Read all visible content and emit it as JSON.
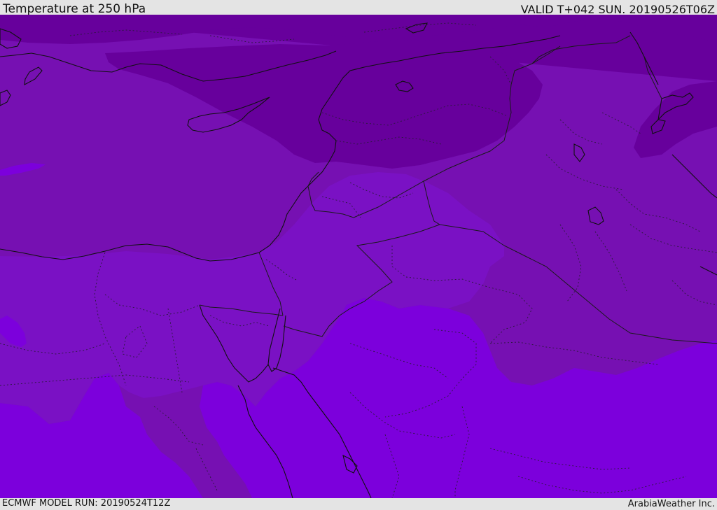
{
  "header": {
    "title": "Temperature at 250 hPa",
    "valid_time": "VALID T+042 SUN. 20190526T06Z"
  },
  "footer": {
    "model_run": "ECMWF MODEL RUN: 20190524T12Z",
    "credit": "ArabiaWeather Inc."
  },
  "map": {
    "variable": "temperature",
    "level": "250 hPa",
    "colors": {
      "coldest": "#67009c",
      "cold": "#7610b2",
      "mild": "#7a11c4",
      "warmest": "#7c00dc",
      "coastline": "#101010",
      "border": "#1a1a1a"
    }
  }
}
